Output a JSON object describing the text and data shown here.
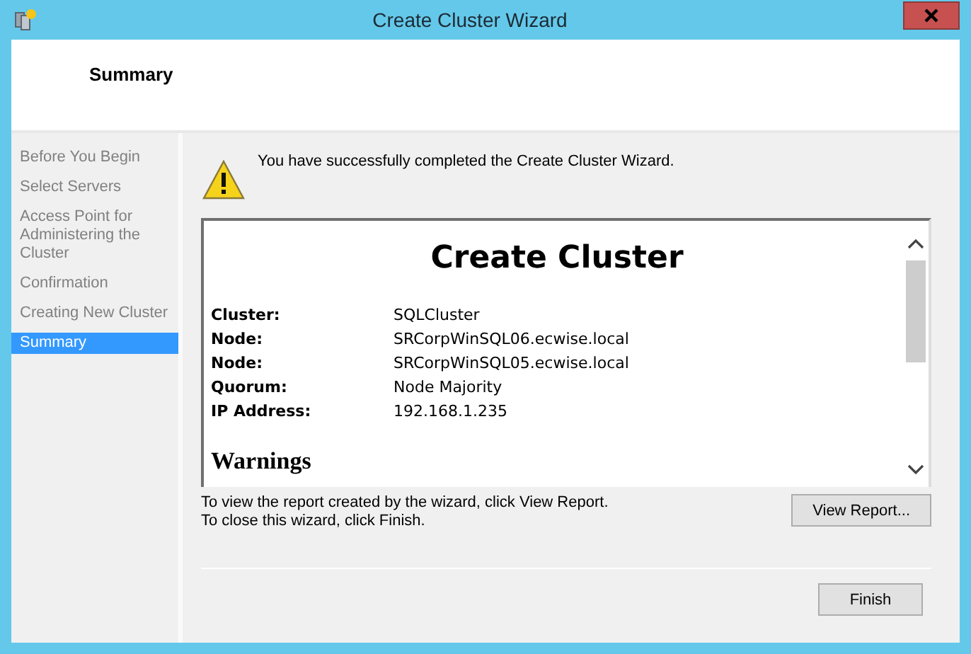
{
  "window": {
    "title": "Create Cluster Wizard"
  },
  "header": {
    "title": "Summary"
  },
  "steps": [
    {
      "label": "Before You Begin",
      "selected": false
    },
    {
      "label": "Select Servers",
      "selected": false
    },
    {
      "label": "Access Point for Administering the Cluster",
      "selected": false
    },
    {
      "label": "Confirmation",
      "selected": false
    },
    {
      "label": "Creating New Cluster",
      "selected": false
    },
    {
      "label": "Summary",
      "selected": true
    }
  ],
  "message": "You have successfully completed the Create Cluster Wizard.",
  "report": {
    "title": "Create Cluster",
    "rows": [
      {
        "label": "Cluster:",
        "value": "SQLCluster"
      },
      {
        "label": "Node:",
        "value": "SRCorpWinSQL06.ecwise.local"
      },
      {
        "label": "Node:",
        "value": "SRCorpWinSQL05.ecwise.local"
      },
      {
        "label": "Quorum:",
        "value": "Node Majority"
      },
      {
        "label": "IP Address:",
        "value": "192.168.1.235"
      }
    ],
    "section": "Warnings"
  },
  "hints": [
    "To view the report created by the wizard, click View Report.",
    "To close this wizard, click Finish."
  ],
  "buttons": {
    "view_report": "View Report...",
    "finish": "Finish"
  }
}
